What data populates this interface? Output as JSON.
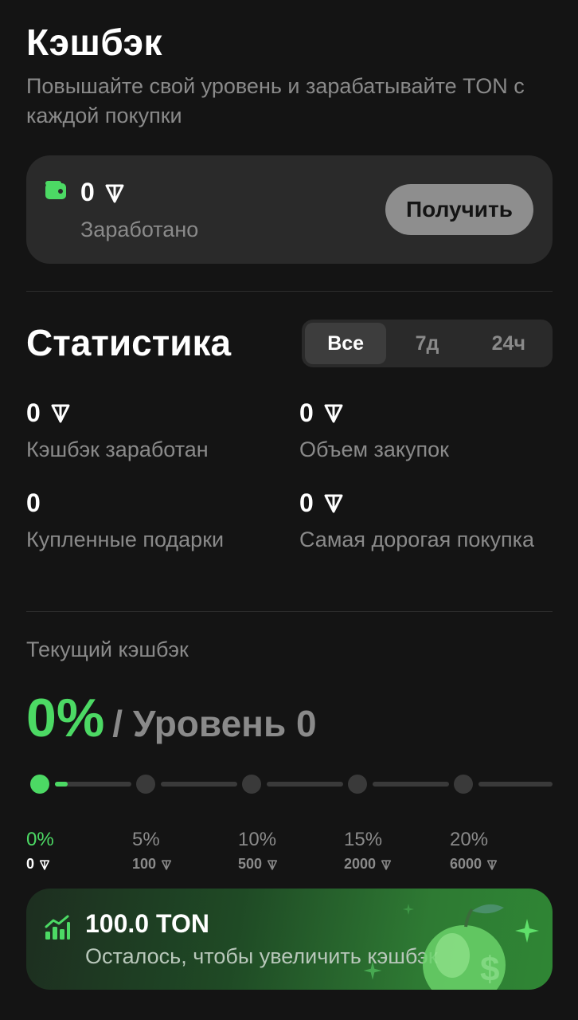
{
  "header": {
    "title": "Кэшбэк",
    "subtitle": "Повышайте свой уровень и зарабатывайте TON с каждой покупки"
  },
  "earned_card": {
    "amount": "0",
    "label": "Заработано",
    "button_label": "Получить",
    "icon": "wallet-icon"
  },
  "stats": {
    "title": "Статистика",
    "periods": [
      "Все",
      "7д",
      "24ч"
    ],
    "selected_period": "Все",
    "items": [
      {
        "value": "0",
        "label": "Кэшбэк заработан",
        "ton": true
      },
      {
        "value": "0",
        "label": "Объем закупок",
        "ton": true
      },
      {
        "value": "0",
        "label": "Купленные подарки",
        "ton": false
      },
      {
        "value": "0",
        "label": "Самая дорогая покупка",
        "ton": true
      }
    ]
  },
  "current": {
    "label": "Текущий кэшбэк",
    "percent": "0%",
    "level": "/ Уровень 0",
    "progress_to_next": 0.15
  },
  "tiers": [
    {
      "percent": "0%",
      "amount": "0",
      "active": true
    },
    {
      "percent": "5%",
      "amount": "100",
      "active": false
    },
    {
      "percent": "10%",
      "amount": "500",
      "active": false
    },
    {
      "percent": "15%",
      "amount": "2000",
      "active": false
    },
    {
      "percent": "20%",
      "amount": "6000",
      "active": false
    }
  ],
  "promo": {
    "title": "100.0 TON",
    "subtitle": "Осталось, чтобы увеличить кэшбэк",
    "icon": "chart-growth-icon"
  },
  "colors": {
    "background": "#141414",
    "card": "#2a2a2a",
    "accent": "#4cd964",
    "muted": "#8a8a8a"
  }
}
